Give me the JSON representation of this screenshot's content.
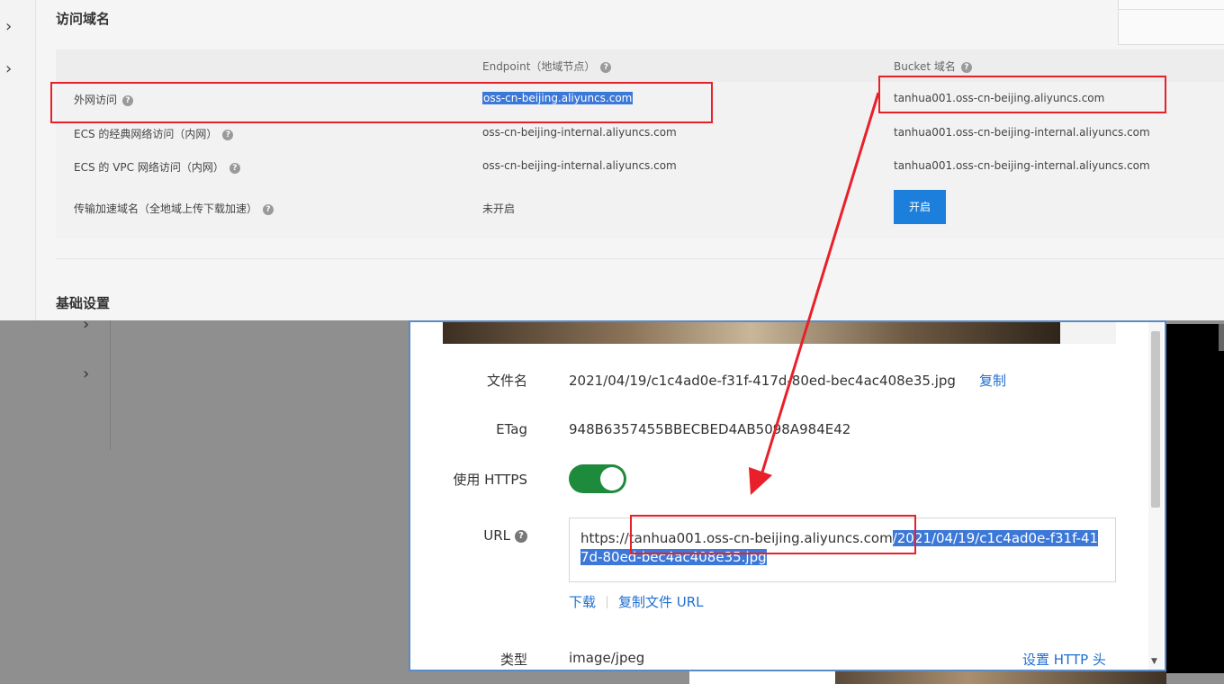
{
  "console": {
    "section_access": "访问域名",
    "section_basic": "基础设置",
    "col_endpoint": "Endpoint（地域节点）",
    "col_bucket": "Bucket 域名",
    "rows": [
      {
        "label": "外网访问",
        "endpoint": "oss-cn-beijing.aliyuncs.com",
        "bucket": "tanhua001.oss-cn-beijing.aliyuncs.com"
      },
      {
        "label": "ECS 的经典网络访问（内网）",
        "endpoint": "oss-cn-beijing-internal.aliyuncs.com",
        "bucket": "tanhua001.oss-cn-beijing-internal.aliyuncs.com"
      },
      {
        "label": "ECS 的 VPC 网络访问（内网）",
        "endpoint": "oss-cn-beijing-internal.aliyuncs.com",
        "bucket": "tanhua001.oss-cn-beijing-internal.aliyuncs.com"
      },
      {
        "label": "传输加速域名（全地域上传下载加速）",
        "endpoint": "未开启"
      }
    ],
    "enable_button": "开启"
  },
  "dialog": {
    "filename_label": "文件名",
    "filename_value": "2021/04/19/c1c4ad0e-f31f-417d-80ed-bec4ac408e35.jpg",
    "copy_link": "复制",
    "etag_label": "ETag",
    "etag_value": "948B6357455BBECBED4AB5098A984E42",
    "https_label": "使用 HTTPS",
    "https_enabled": true,
    "url_label": "URL",
    "url_prefix": "https://",
    "url_host": "tanhua001.oss-cn-beijing.aliyuncs.com",
    "url_path": "/2021/04/19/c1c4ad0e-f31f-417d-80ed-bec4ac408e35.jpg",
    "download_link": "下载",
    "copy_url_link": "复制文件 URL",
    "type_label": "类型",
    "type_value": "image/jpeg",
    "set_http_header_link": "设置 HTTP 头"
  },
  "icons": {
    "chevron": "chevron-right-icon",
    "help": "help-circle-icon"
  },
  "colors": {
    "annotation_red": "#e8202a",
    "selection_blue": "#3b78d8",
    "toggle_green": "#1e8a3c",
    "link_blue": "#1f6fd1",
    "button_blue": "#1c7fdc"
  }
}
